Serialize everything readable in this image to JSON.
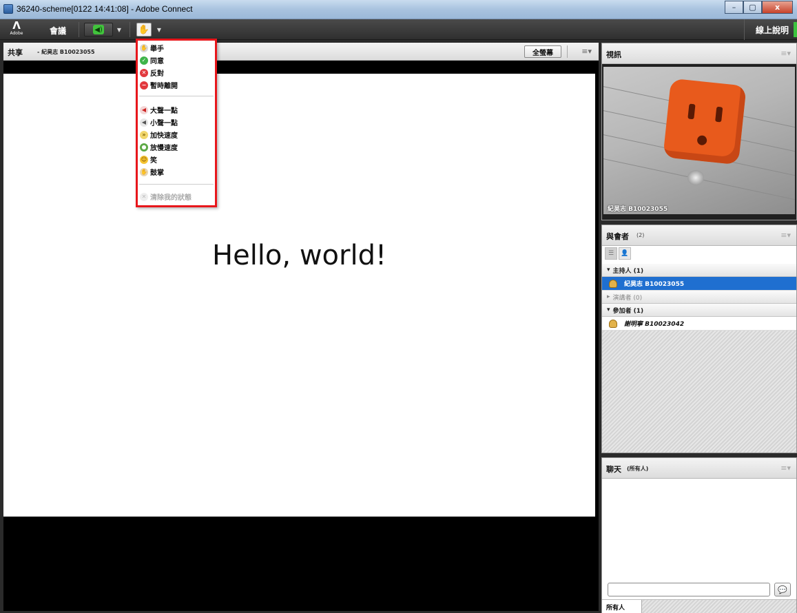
{
  "window": {
    "title": "36240-scheme[0122 14:41:08] - Adobe Connect",
    "minimize": "–",
    "maximize": "▢",
    "close": "x"
  },
  "toolbar": {
    "logo_mark": "Λ",
    "logo_text": "Adobe",
    "meeting_menu": "會議",
    "help": "線上說明"
  },
  "share_pod": {
    "title": "共享",
    "presenter": "- 紀昊志 B10023055",
    "fullscreen_button": "全螢幕",
    "menu_icon": "≡▾",
    "slide_text": "Hello, world!"
  },
  "video_pod": {
    "title": "視訊",
    "menu_icon": "≡▾",
    "camera_name": "紀昊志 B10023055"
  },
  "attendee_pod": {
    "title": "與會者",
    "count": "(2)",
    "menu_icon": "≡▾",
    "groups": [
      {
        "label": "主持人 (1)",
        "arrow": "▾"
      },
      {
        "label": "演講者 (0)",
        "arrow": "▸"
      },
      {
        "label": "參加者 (1)",
        "arrow": "▾"
      }
    ],
    "hosts": [
      "紀昊志 B10023055"
    ],
    "participants": [
      "謝明寧 B10023042"
    ]
  },
  "chat_pod": {
    "title": "聊天",
    "scope": "(所有人)",
    "menu_icon": "≡▾",
    "tab": "所有人"
  },
  "status_menu": {
    "items": [
      {
        "label": "舉手",
        "icon": "raise-hand-icon"
      },
      {
        "label": "同意",
        "icon": "agree-icon"
      },
      {
        "label": "反對",
        "icon": "disagree-icon"
      },
      {
        "label": "暫時離開",
        "icon": "step-away-icon"
      },
      {
        "label": "大聲一點",
        "icon": "speak-louder-icon"
      },
      {
        "label": "小聲一點",
        "icon": "speak-softer-icon"
      },
      {
        "label": "加快速度",
        "icon": "speed-up-icon"
      },
      {
        "label": "放慢速度",
        "icon": "slow-down-icon"
      },
      {
        "label": "笑",
        "icon": "laughter-icon"
      },
      {
        "label": "鼓掌",
        "icon": "applause-icon"
      }
    ],
    "clear_label": "清除我的狀態"
  },
  "colors": {
    "highlight_border": "#e8161b",
    "selected_row": "#1f6fd0",
    "speaker_green": "#41c33c"
  }
}
